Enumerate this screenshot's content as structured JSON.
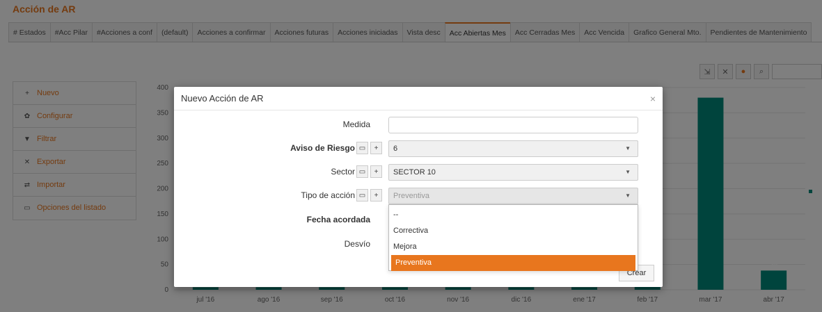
{
  "page": {
    "title": "Acción de AR",
    "tabs": [
      {
        "label": "# Estados"
      },
      {
        "label": "#Acc Pilar"
      },
      {
        "label": "#Acciones a conf"
      },
      {
        "label": "(default)"
      },
      {
        "label": "Acciones a confirmar"
      },
      {
        "label": "Acciones futuras"
      },
      {
        "label": "Acciones iniciadas"
      },
      {
        "label": "Vista desc"
      },
      {
        "label": "Acc Abiertas Mes",
        "active": true
      },
      {
        "label": "Acc Cerradas Mes"
      },
      {
        "label": "Acc Vencida"
      },
      {
        "label": "Grafico General Mto."
      },
      {
        "label": "Pendientes de Mantenimiento"
      }
    ],
    "sidemenu": [
      {
        "icon": "+",
        "label": "Nuevo"
      },
      {
        "icon": "✿",
        "label": "Configurar"
      },
      {
        "icon": "▼",
        "label": "Filtrar"
      },
      {
        "icon": "✕",
        "label": "Exportar"
      },
      {
        "icon": "⇄",
        "label": "Importar"
      },
      {
        "icon": "▭",
        "label": "Opciones del listado"
      }
    ]
  },
  "chart_data": {
    "type": "bar",
    "categories": [
      "jul '16",
      "ago '16",
      "sep '16",
      "oct '16",
      "nov '16",
      "dic '16",
      "ene '17",
      "feb '17",
      "mar '17",
      "abr '17"
    ],
    "values": [
      5,
      5,
      5,
      5,
      5,
      5,
      5,
      190,
      380,
      38
    ],
    "data_labels": {
      "mar '17": "380",
      "abr '17": "38"
    },
    "yticks": [
      0,
      50,
      100,
      150,
      200,
      250,
      300,
      350,
      400
    ],
    "ylim": [
      0,
      400
    ],
    "color": "#00897b",
    "grid": true
  },
  "modal": {
    "title": "Nuevo Acción de AR",
    "close": "×",
    "fields": {
      "medida": {
        "label": "Medida",
        "value": ""
      },
      "aviso": {
        "label": "Aviso de Riesgo",
        "value": "6"
      },
      "sector": {
        "label": "Sector",
        "value": "SECTOR 10"
      },
      "tipo": {
        "label": "Tipo de acción",
        "value": "Preventiva"
      },
      "fecha": {
        "label": "Fecha acordada"
      },
      "desvio": {
        "label": "Desvío"
      }
    },
    "tipo_options": [
      "--",
      "Correctiva",
      "Mejora",
      "Preventiva"
    ],
    "submit": "Crear"
  },
  "colors": {
    "accent": "#e8761e",
    "bar": "#00897b"
  }
}
